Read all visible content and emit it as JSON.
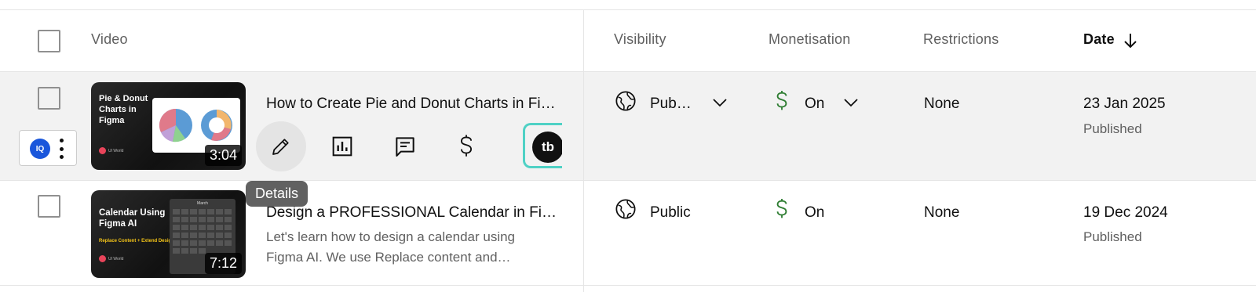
{
  "header": {
    "video": "Video",
    "visibility": "Visibility",
    "monetisation": "Monetisation",
    "restrictions": "Restrictions",
    "date": "Date"
  },
  "rows": [
    {
      "thumb_title": "Pie & Donut Charts in Figma",
      "thumb_brand": "UI World",
      "duration": "3:04",
      "title": "How to Create Pie and Donut Charts in Figma",
      "visibility": "Pub…",
      "monetisation": "On",
      "restrictions": "None",
      "date": "23 Jan 2025",
      "status": "Published"
    },
    {
      "thumb_title": "Calendar Using Figma AI",
      "thumb_subtitle": "Replace Content + Extend Design",
      "thumb_month": "March",
      "thumb_brand": "UI World",
      "duration": "7:12",
      "title": "Design a PROFESSIONAL Calendar in Figma",
      "description_line1": "Let's learn how to design a calendar using",
      "description_line2": "Figma AI. We use Replace content and…",
      "visibility": "Public",
      "monetisation": "On",
      "restrictions": "None",
      "date": "19 Dec 2024",
      "status": "Published"
    }
  ],
  "tooltip": "Details",
  "extension_logo": "IQ",
  "tubebuddy_logo": "tb",
  "colors": {
    "monetisation_icon": "#2e7d32",
    "row_hover": "#f2f2f2",
    "tubebuddy_border": "#4fd1c5"
  }
}
